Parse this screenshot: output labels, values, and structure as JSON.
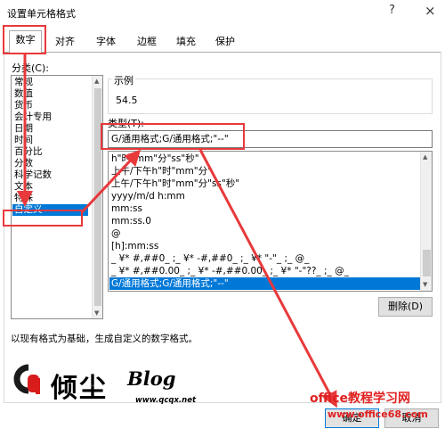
{
  "dialog": {
    "title": "设置单元格格式",
    "help": "?",
    "close": "×"
  },
  "tabs": [
    {
      "label": "数字"
    },
    {
      "label": "对齐"
    },
    {
      "label": "字体"
    },
    {
      "label": "边框"
    },
    {
      "label": "填充"
    },
    {
      "label": "保护"
    }
  ],
  "category": {
    "label": "分类(C):",
    "items": [
      "常规",
      "数值",
      "货币",
      "会计专用",
      "日期",
      "时间",
      "百分比",
      "分数",
      "科学记数",
      "文本",
      "特殊",
      "自定义"
    ],
    "selected": "自定义"
  },
  "sample": {
    "label": "示例",
    "value": "54.5"
  },
  "type": {
    "label": "类型(T):",
    "value": "G/通用格式;G/通用格式;\"--\""
  },
  "formats": [
    "h\"时\"mm\"分\"ss\"秒\"",
    "上午/下午h\"时\"mm\"分\"",
    "上午/下午h\"时\"mm\"分\"ss\"秒\"",
    "yyyy/m/d h:mm",
    "mm:ss",
    "mm:ss.0",
    "@",
    "[h]:mm:ss",
    "_ ¥* #,##0_ ;_ ¥* -#,##0_ ;_ ¥* \"-\"_ ;_ @_",
    "_ ¥* #,##0.00_ ;_ ¥* -#,##0.00_ ;_ ¥* \"-\"??_ ;_ @_",
    "G/通用格式;G/通用格式;\"--\""
  ],
  "delete_button": "删除(D)",
  "description": "以现有格式为基础，生成自定义的数字格式。",
  "ok_button": "确定",
  "cancel_button": "取消",
  "watermark": {
    "logo_cn": "倾尘",
    "logo_blog": "Blog",
    "logo_url": "www.qcqx.net",
    "office_cn": "office教程学习网",
    "office_url": "www.office68.com"
  },
  "colors": {
    "selection": "#0078d7",
    "annotation": "#e8393b"
  }
}
